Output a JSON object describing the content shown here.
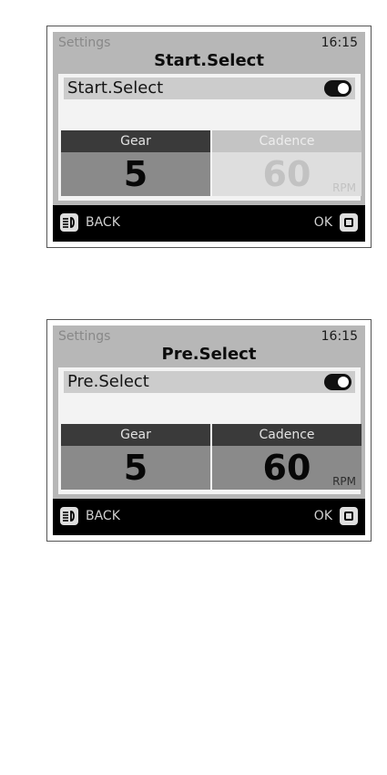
{
  "screens": [
    {
      "breadcrumb": "Settings",
      "time": "16:15",
      "title": "Start.Select",
      "option": {
        "label": "Start.Select",
        "toggle": "on"
      },
      "gear": {
        "label": "Gear",
        "value": "5"
      },
      "cadence": {
        "label": "Cadence",
        "value": "60",
        "unit": "RPM",
        "state": "disabled"
      },
      "footer": {
        "back_label": "BACK",
        "back_icon": "headlight-icon",
        "ok_label": "OK",
        "ok_icon": "square-button-icon"
      }
    },
    {
      "breadcrumb": "Settings",
      "time": "16:15",
      "title": "Pre.Select",
      "option": {
        "label": "Pre.Select",
        "toggle": "on"
      },
      "gear": {
        "label": "Gear",
        "value": "5"
      },
      "cadence": {
        "label": "Cadence",
        "value": "60",
        "unit": "RPM",
        "state": "enabled"
      },
      "footer": {
        "back_label": "BACK",
        "back_icon": "headlight-icon",
        "ok_label": "OK",
        "ok_icon": "square-button-icon"
      }
    }
  ],
  "colors": {
    "screen_bg": "#b7b7b7",
    "bar_bg": "#000000",
    "active_header": "#3a3a3a",
    "disabled_value": "#c2c2c2"
  }
}
